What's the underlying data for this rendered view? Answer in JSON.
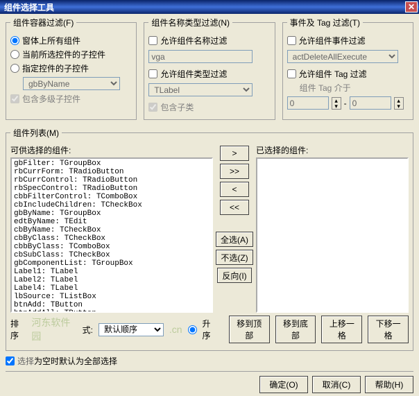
{
  "window": {
    "title": "组件选择工具"
  },
  "filter_container": {
    "legend": "组件容器过滤(F)",
    "r1": "窗体上所有组件",
    "r2": "当前所选控件的子控件",
    "r3": "指定控件的子控件",
    "combo": "gbByName",
    "cb_multi": "包含多级子控件"
  },
  "filter_name": {
    "legend": "组件名称类型过滤(N)",
    "cb_name": "允许组件名称过滤",
    "name_val": "vga",
    "cb_type": "允许组件类型过滤",
    "type_val": "TLabel",
    "cb_sub": "包含子类"
  },
  "filter_event": {
    "legend": "事件及 Tag 过滤(T)",
    "cb_event": "允许组件事件过滤",
    "event_val": "actDeleteAllExecute",
    "cb_tag": "允许组件 Tag 过滤",
    "tag_label": "组件 Tag 介于",
    "from": "0",
    "dash": "-",
    "to": "0"
  },
  "lists": {
    "legend": "组件列表(M)",
    "avail": "可供选择的组件:",
    "selected": "已选择的组件:",
    "btn_add": ">",
    "btn_addall": ">>",
    "btn_rem": "<",
    "btn_remall": "<<",
    "btn_selall": "全选(A)",
    "btn_none": "不选(Z)",
    "btn_invert": "反向(I)"
  },
  "list_items": [
    "gbFilter: TGroupBox",
    "rbCurrForm: TRadioButton",
    "rbCurrControl: TRadioButton",
    "rbSpecControl: TRadioButton",
    "cbbFilterControl: TComboBox",
    "cbIncludeChildren: TCheckBox",
    "gbByName: TGroupBox",
    "edtByName: TEdit",
    "cbByName: TCheckBox",
    "cbByClass: TCheckBox",
    "cbbByClass: TComboBox",
    "cbSubClass: TCheckBox",
    "gbComponentList: TGroupBox",
    "Label1: TLabel",
    "Label2: TLabel",
    "Label4: TLabel",
    "lbSource: TListBox",
    "btnAdd: TButton",
    "btnAddAll: TButton"
  ],
  "sort": {
    "label_pre": "排序",
    "label_post": "式:",
    "val": "默认顺序",
    "asc": "升序"
  },
  "btns_move": {
    "top": "移到顶部",
    "bottom": "移到底部",
    "up": "上移一格",
    "down": "下移一格"
  },
  "cb_default": {
    "pre": "选择",
    "post": "为空时默认为全部选择"
  },
  "wm": {
    "a": "河东软件园",
    "b": ".cn"
  },
  "btns_main": {
    "ok": "确定(O)",
    "cancel": "取消(C)",
    "help": "帮助(H)"
  }
}
